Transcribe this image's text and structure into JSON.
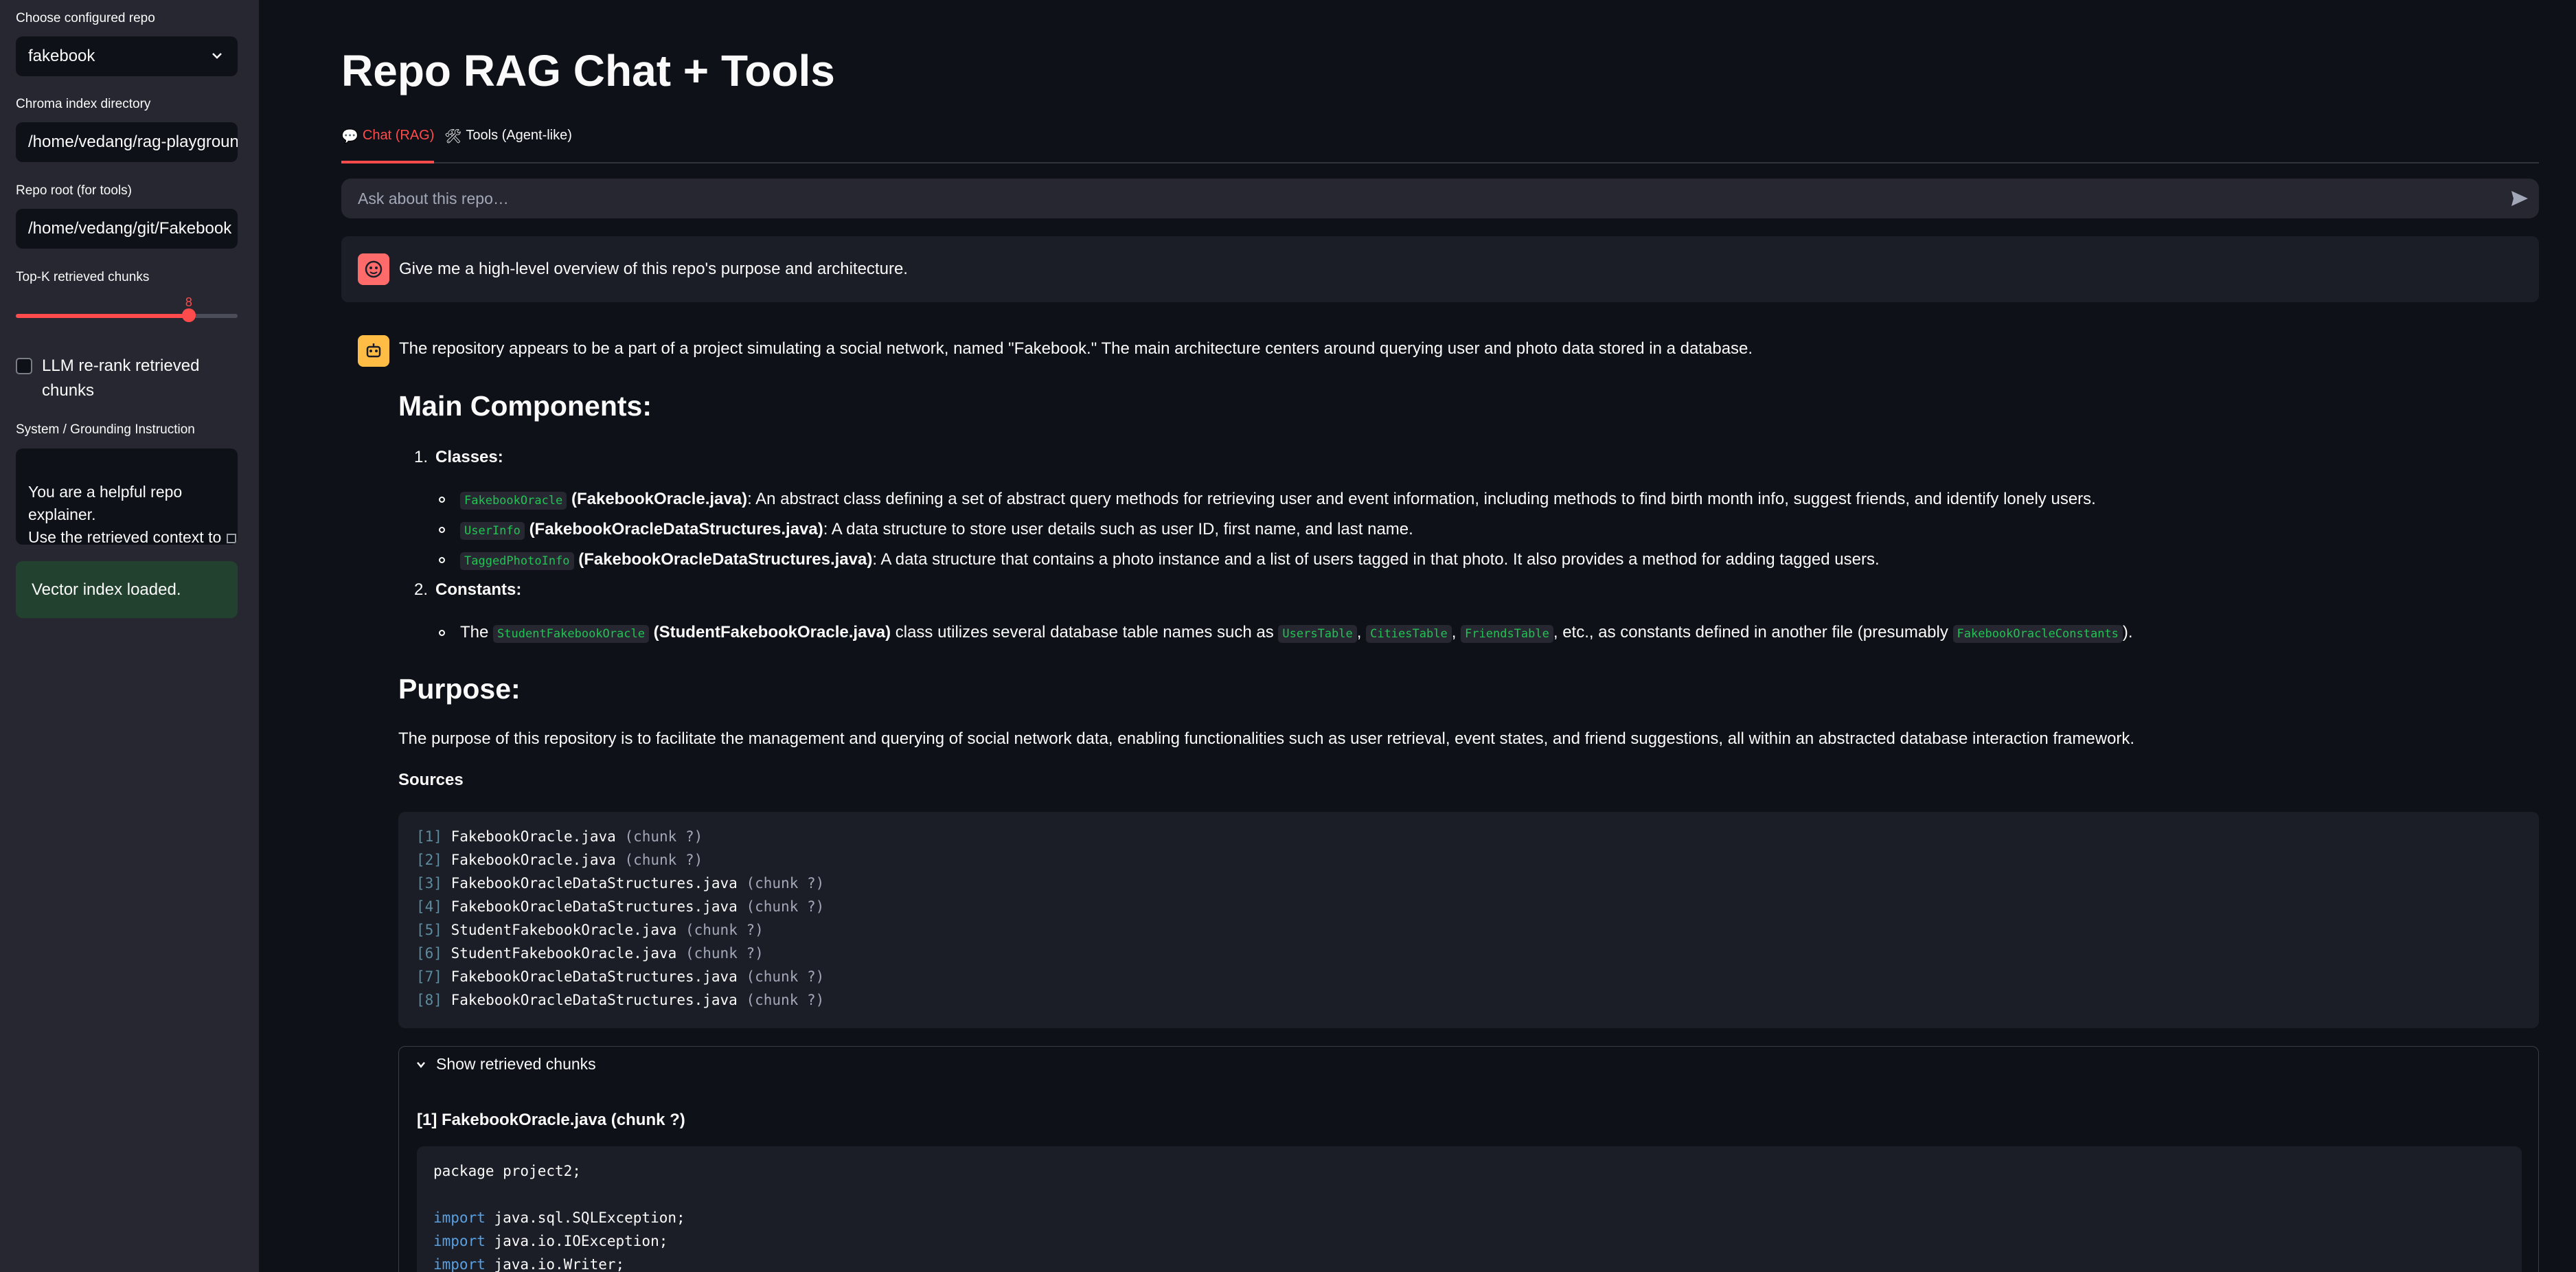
{
  "sidebar": {
    "repo_label": "Choose configured repo",
    "repo_value": "fakebook",
    "chroma_label": "Chroma index directory",
    "chroma_value": "/home/vedang/rag-playground",
    "root_label": "Repo root (for tools)",
    "root_value": "/home/vedang/git/Fakebook",
    "topk_label": "Top-K retrieved chunks",
    "topk_value": "8",
    "topk_fraction": 0.78,
    "rerank_label": "LLM re-rank retrieved chunks",
    "rerank_checked": false,
    "system_label": "System / Grounding Instruction",
    "system_value": "You are a helpful repo explainer.\nUse the retrieved context to answer.",
    "status": "Vector index loaded."
  },
  "main": {
    "title": "Repo RAG Chat + Tools",
    "tabs": [
      {
        "icon": "💬",
        "label": "Chat (RAG)",
        "active": true
      },
      {
        "icon": "🛠",
        "label": "Tools (Agent-like)",
        "active": false
      }
    ],
    "chat_placeholder": "Ask about this repo…"
  },
  "conversation": {
    "user_message": "Give me a high-level overview of this repo's purpose and architecture.",
    "intro": "The repository appears to be a part of a project simulating a social network, named \"Fakebook.\" The main architecture centers around querying user and photo data stored in a database.",
    "heading_components": "Main Components:",
    "classes_num": "1.",
    "classes_label": "Classes:",
    "class_items": [
      {
        "code": "FakebookOracle",
        "file": "(FakebookOracle.java)",
        "desc": ": An abstract class defining a set of abstract query methods for retrieving user and event information, including methods to find birth month info, suggest friends, and identify lonely users."
      },
      {
        "code": "UserInfo",
        "file": "(FakebookOracleDataStructures.java)",
        "desc": ": A data structure to store user details such as user ID, first name, and last name."
      },
      {
        "code": "TaggedPhotoInfo",
        "file": "(FakebookOracleDataStructures.java)",
        "desc": ": A data structure that contains a photo instance and a list of users tagged in that photo. It also provides a method for adding tagged users."
      }
    ],
    "constants_num": "2.",
    "constants_label": "Constants:",
    "constants_item": {
      "pre": "The",
      "code": "StudentFakebookOracle",
      "file": "(StudentFakebookOracle.java)",
      "mid": "class utilizes several database table names such as",
      "tables": [
        "UsersTable",
        "CitiesTable",
        "FriendsTable"
      ],
      "post": ", etc., as constants defined in another file (presumably",
      "ref": "FakebookOracleConstants",
      "end": ")."
    },
    "heading_purpose": "Purpose:",
    "purpose_text": "The purpose of this repository is to facilitate the management and querying of social network data, enabling functionalities such as user retrieval, event states, and friend suggestions, all within an abstracted database interaction framework.",
    "sources_label": "Sources",
    "sources": [
      {
        "idx": "[1]",
        "file": "FakebookOracle.java",
        "chunk": "(chunk ?)"
      },
      {
        "idx": "[2]",
        "file": "FakebookOracle.java",
        "chunk": "(chunk ?)"
      },
      {
        "idx": "[3]",
        "file": "FakebookOracleDataStructures.java",
        "chunk": "(chunk ?)"
      },
      {
        "idx": "[4]",
        "file": "FakebookOracleDataStructures.java",
        "chunk": "(chunk ?)"
      },
      {
        "idx": "[5]",
        "file": "StudentFakebookOracle.java",
        "chunk": "(chunk ?)"
      },
      {
        "idx": "[6]",
        "file": "StudentFakebookOracle.java",
        "chunk": "(chunk ?)"
      },
      {
        "idx": "[7]",
        "file": "FakebookOracleDataStructures.java",
        "chunk": "(chunk ?)"
      },
      {
        "idx": "[8]",
        "file": "FakebookOracleDataStructures.java",
        "chunk": "(chunk ?)"
      }
    ],
    "expander_label": "Show retrieved chunks",
    "chunk_title": "[1] FakebookOracle.java (chunk ?)",
    "code_lines": [
      {
        "kw": "",
        "text": "package project2;"
      },
      {
        "kw": "",
        "text": ""
      },
      {
        "kw": "import",
        "text": " java.sql.SQLException;"
      },
      {
        "kw": "import",
        "text": " java.io.IOException;"
      },
      {
        "kw": "import",
        "text": " java.io.Writer;"
      }
    ]
  },
  "colors": {
    "accent": "#ff4b4b",
    "code_green": "#21c354",
    "status_bg": "#23412f",
    "user_avatar": "#ff6b6b",
    "assistant_avatar": "#ffbd45"
  }
}
